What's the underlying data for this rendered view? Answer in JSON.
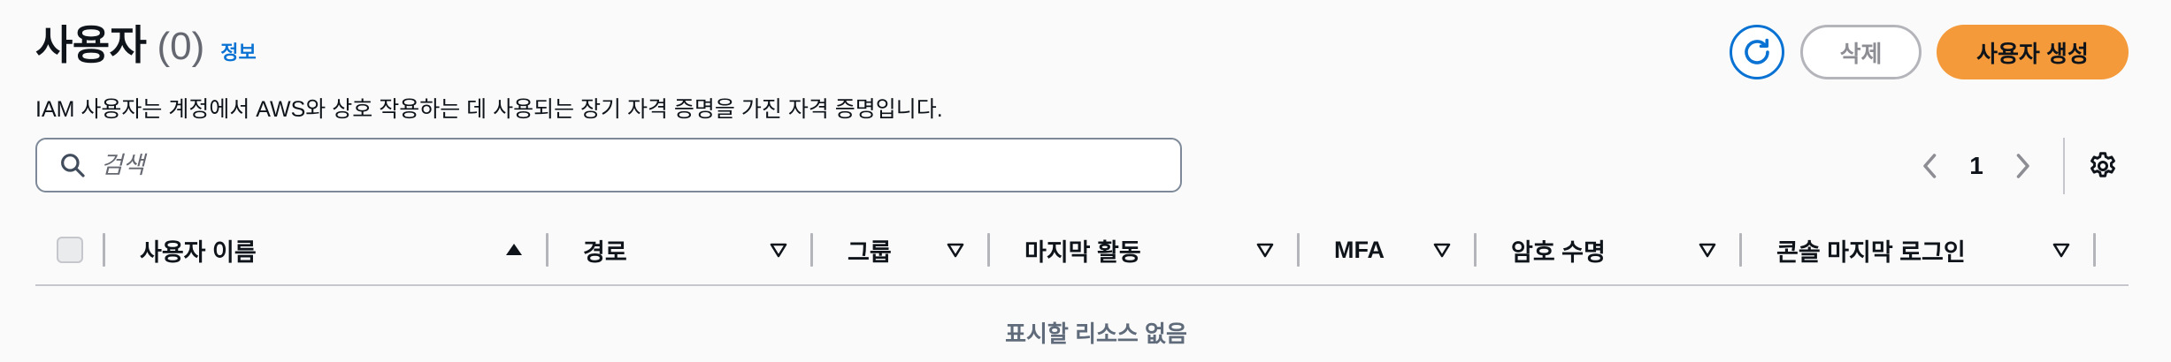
{
  "header": {
    "title": "사용자",
    "count": "(0)",
    "info_link": "정보",
    "description": "IAM 사용자는 계정에서 AWS와 상호 작용하는 데 사용되는 장기 자격 증명을 가진 자격 증명입니다."
  },
  "actions": {
    "refresh_icon": "refresh-icon",
    "delete_label": "삭제",
    "create_label": "사용자 생성"
  },
  "search": {
    "placeholder": "검색",
    "value": "",
    "icon": "search-icon"
  },
  "pagination": {
    "current_page": "1",
    "prev_icon": "chevron-left-icon",
    "next_icon": "chevron-right-icon",
    "settings_icon": "gear-icon"
  },
  "table": {
    "columns": [
      {
        "label": "사용자 이름",
        "sort": "ascending"
      },
      {
        "label": "경로",
        "sort": "none"
      },
      {
        "label": "그룹",
        "sort": "none"
      },
      {
        "label": "마지막 활동",
        "sort": "none"
      },
      {
        "label": "MFA",
        "sort": "none"
      },
      {
        "label": "암호 수명",
        "sort": "none"
      },
      {
        "label": "콘솔 마지막 로그인",
        "sort": "none"
      }
    ],
    "rows": [],
    "empty_message": "표시할 리소스 없음"
  },
  "colors": {
    "accent": "#0972d3",
    "primary_button": "#f49a3a",
    "text": "#0f141a",
    "muted": "#656871",
    "border": "#c6c6cd"
  }
}
